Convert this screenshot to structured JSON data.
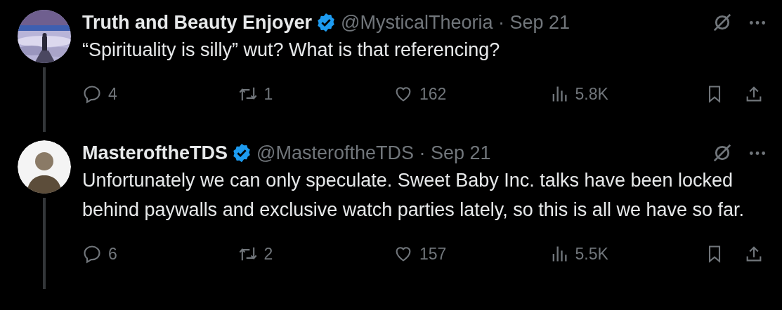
{
  "tweets": [
    {
      "author": "Truth and Beauty Enjoyer",
      "verified": true,
      "meta": "@MysticalTheoria · Sep 21",
      "text": "“Spirituality is silly” wut? What is that referencing?",
      "replies": "4",
      "reposts": "1",
      "likes": "162",
      "views": "5.8K"
    },
    {
      "author": "MasteroftheTDS",
      "verified": true,
      "meta": "@MasteroftheTDS · Sep 21",
      "text": "Unfortunately we can only speculate. Sweet Baby Inc. talks have been locked behind paywalls and exclusive watch parties lately, so this is all we have so far.",
      "avatar": {
        "kind": "silhouette"
      },
      "replies": "6",
      "reposts": "2",
      "likes": "157",
      "views": "5.5K"
    }
  ]
}
